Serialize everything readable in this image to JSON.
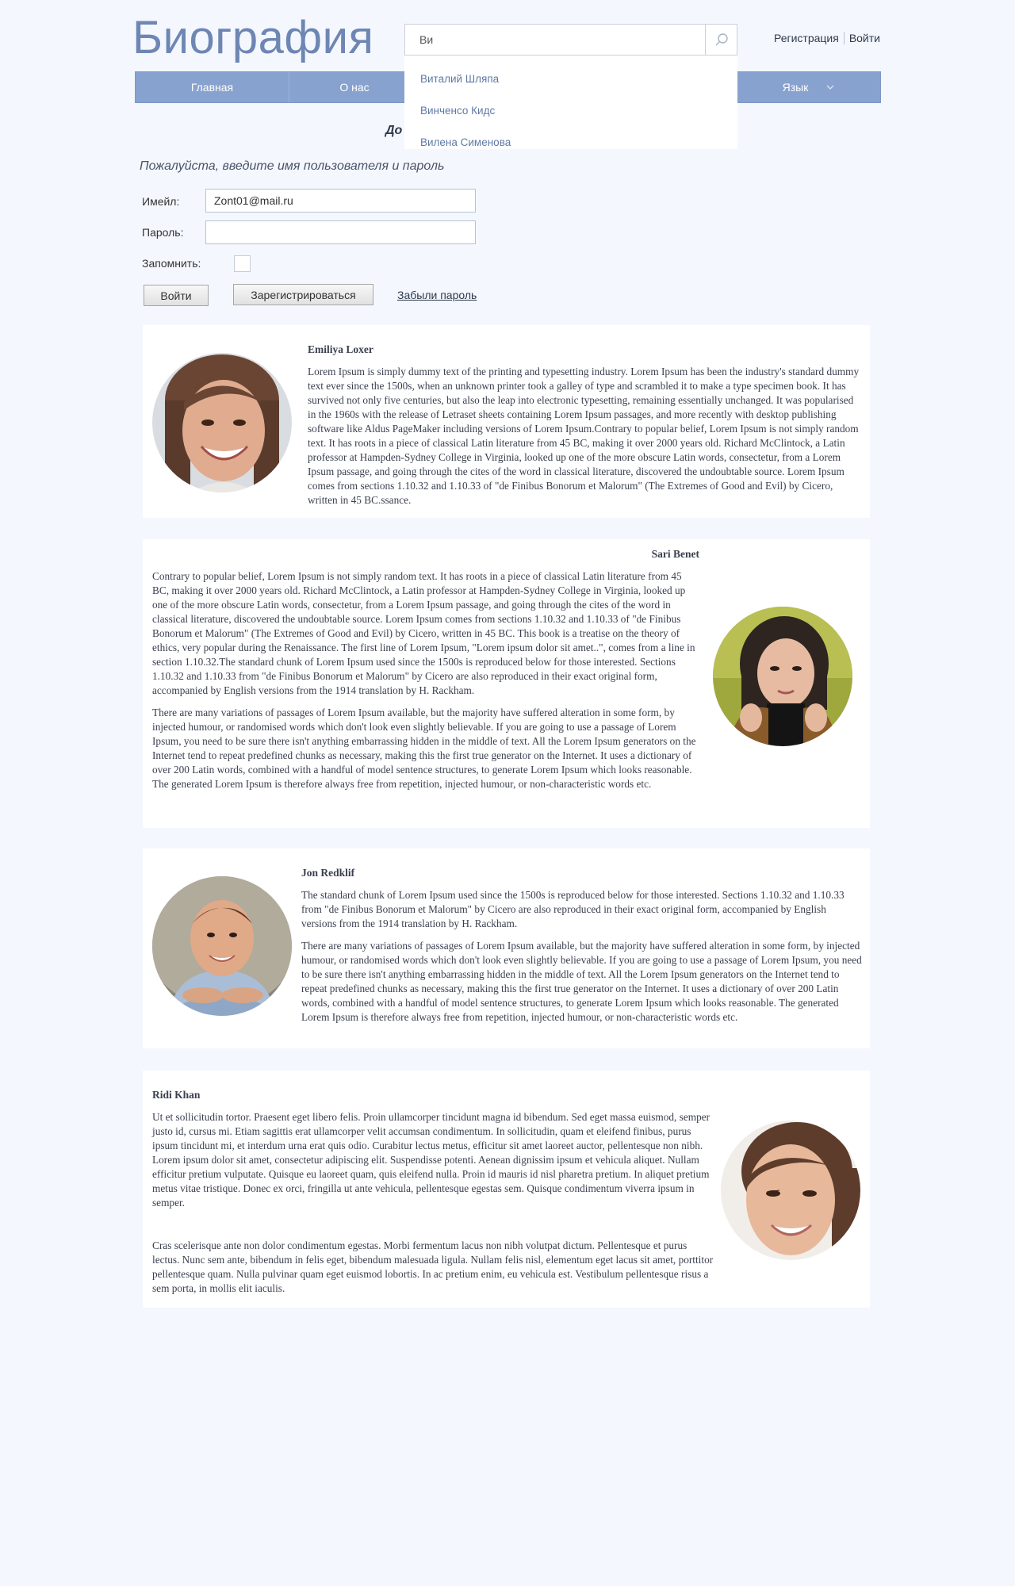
{
  "header": {
    "logo": "Биография",
    "search": {
      "value": "Ви",
      "suggestions": [
        "Виталий Шляпа",
        "Винченсо Кидс",
        "Вилена Сименова"
      ]
    },
    "auth": {
      "register": "Регистрация",
      "login": "Войти"
    }
  },
  "nav": {
    "items": [
      "Главная",
      "О нас",
      "Язык"
    ]
  },
  "partial_heading": "До",
  "login_form": {
    "prompt": "Пожалуйста, введите имя пользователя и пароль",
    "email_label": "Имейл:",
    "email_value": "Zont01@mail.ru",
    "password_label": "Пароль:",
    "password_value": "",
    "remember_label": "Запомнить:",
    "login_button": "Войти",
    "register_button": "Зарегистрироваться",
    "forgot_link": "Забыли пароль"
  },
  "colors": {
    "accent": "#88a2cf",
    "logo": "#6e86b3",
    "link": "#5f7aa6",
    "background": "#f4f7fd"
  },
  "profiles": [
    {
      "name": "Emiliya Loxer",
      "paragraphs": [
        "Lorem Ipsum is simply dummy text of the printing and typesetting industry. Lorem Ipsum has been the industry's standard dummy text ever since the 1500s, when an unknown printer took a galley of type and scrambled it to make a type specimen book. It has survived not only five centuries, but also the leap into electronic typesetting, remaining essentially unchanged. It was popularised in the 1960s with the release of Letraset sheets containing Lorem Ipsum passages, and more recently with desktop publishing software like Aldus PageMaker including versions of Lorem Ipsum.Contrary to popular belief, Lorem Ipsum is not simply random text. It has roots in a piece of classical Latin literature from 45 BC, making it over 2000 years old. Richard McClintock, a Latin professor at Hampden-Sydney College in Virginia, looked up one of the more obscure Latin words, consectetur, from a Lorem Ipsum passage, and going through the cites of the word in classical literature, discovered the undoubtable source. Lorem Ipsum comes from sections 1.10.32 and 1.10.33 of \"de Finibus Bonorum et Malorum\" (The Extremes of Good and Evil) by Cicero, written in 45 BC.ssance."
      ]
    },
    {
      "name": "Sari Benet",
      "paragraphs": [
        "Contrary to popular belief, Lorem Ipsum is not simply random text. It has roots in a piece of classical Latin literature from 45 BC, making it over 2000 years old. Richard McClintock, a Latin professor at Hampden-Sydney College in Virginia, looked up one of the more obscure Latin words, consectetur, from a Lorem Ipsum passage, and going through the cites of the word in classical literature, discovered the undoubtable source. Lorem Ipsum comes from sections 1.10.32 and 1.10.33 of \"de Finibus Bonorum et Malorum\" (The Extremes of Good and Evil) by Cicero, written in 45 BC. This book is a treatise on the theory of ethics, very popular during the Renaissance. The first line of Lorem Ipsum, \"Lorem ipsum dolor sit amet..\", comes from a line in section 1.10.32.The standard chunk of Lorem Ipsum used since the 1500s is reproduced below for those interested. Sections 1.10.32 and 1.10.33 from \"de Finibus Bonorum et Malorum\" by Cicero are also reproduced in their exact original form, accompanied by English versions from the 1914 translation by H. Rackham.",
        "There are many variations of passages of Lorem Ipsum available, but the majority have suffered alteration in some form, by injected humour, or randomised words which don't look even slightly believable. If you are going to use a passage of Lorem Ipsum, you need to be sure there isn't anything embarrassing hidden in the middle of text. All the Lorem Ipsum generators on the Internet tend to repeat predefined chunks as necessary, making this the first true generator on the Internet. It uses a dictionary of over 200 Latin words, combined with a handful of model sentence structures, to generate Lorem Ipsum which looks reasonable. The generated Lorem Ipsum is therefore always free from repetition, injected humour, or non-characteristic words etc."
      ]
    },
    {
      "name": "Jon Redklif",
      "paragraphs": [
        "The standard chunk of Lorem Ipsum used since the 1500s is reproduced below for those interested. Sections 1.10.32 and 1.10.33 from \"de Finibus Bonorum et Malorum\" by Cicero are also reproduced in their exact original form, accompanied by English versions from the 1914 translation by H. Rackham.",
        "There are many variations of passages of Lorem Ipsum available, but the majority have suffered alteration in some form, by injected humour, or randomised words which don't look even slightly believable. If you are going to use a passage of Lorem Ipsum, you need to be sure there isn't anything embarrassing hidden in the middle of text. All the Lorem Ipsum generators on the Internet tend to repeat predefined chunks as necessary, making this the first true generator on the Internet. It uses a dictionary of over 200 Latin words, combined with a handful of model sentence structures, to generate Lorem Ipsum which looks reasonable. The generated Lorem Ipsum is therefore always free from repetition, injected humour, or non-characteristic words etc."
      ]
    },
    {
      "name": "Ridi Khan",
      "paragraphs": [
        "Ut et sollicitudin tortor. Praesent eget libero felis. Proin ullamcorper tincidunt magna id bibendum. Sed eget massa euismod, semper justo id, cursus mi. Etiam sagittis erat ullamcorper velit accumsan condimentum. In sollicitudin, quam et eleifend finibus, purus ipsum tincidunt mi, et interdum urna erat quis odio. Curabitur lectus metus, efficitur sit amet laoreet auctor, pellentesque non nibh. Lorem ipsum dolor sit amet, consectetur adipiscing elit. Suspendisse potenti. Aenean dignissim ipsum et vehicula aliquet. Nullam efficitur pretium vulputate. Quisque eu laoreet quam, quis eleifend nulla. Proin id mauris id nisl pharetra pretium. In aliquet pretium metus vitae tristique. Donec ex orci, fringilla ut ante vehicula, pellentesque egestas sem. Quisque condimentum viverra ipsum in semper.",
        "Cras scelerisque ante non dolor condimentum egestas. Morbi fermentum lacus non nibh volutpat dictum. Pellentesque et purus lectus. Nunc sem ante, bibendum in felis eget, bibendum malesuada ligula. Nullam felis nisl, elementum eget lacus sit amet, porttitor pellentesque quam. Nulla pulvinar quam eget euismod lobortis. In ac pretium enim, eu vehicula est. Vestibulum pellentesque risus a sem porta, in mollis elit iaculis."
      ]
    }
  ]
}
